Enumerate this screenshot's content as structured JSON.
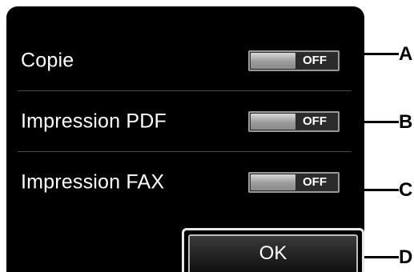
{
  "settings": [
    {
      "label": "Copie",
      "state": "OFF",
      "callout": "A"
    },
    {
      "label": "Impression PDF",
      "state": "OFF",
      "callout": "B"
    },
    {
      "label": "Impression FAX",
      "state": "OFF",
      "callout": "C"
    }
  ],
  "ok_button": {
    "label": "OK",
    "callout": "D"
  }
}
